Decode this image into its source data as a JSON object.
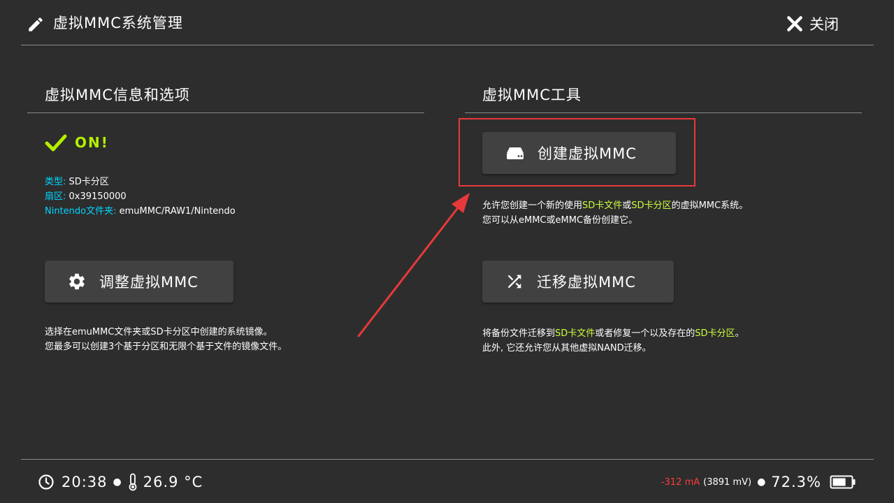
{
  "header": {
    "title": "虚拟MMC系统管理",
    "close_label": "关闭"
  },
  "left": {
    "section_title": "虚拟MMC信息和选项",
    "status": "ON!",
    "info": [
      {
        "key": "类型",
        "sep": ": ",
        "value": "SD卡分区"
      },
      {
        "key": "扇区",
        "sep": ": ",
        "value": "0x39150000"
      },
      {
        "key": "Nintendo文件夹",
        "sep": ": ",
        "value": "emuMMC/RAW1/Nintendo"
      }
    ],
    "adjust_button": "调整虚拟MMC",
    "adjust_desc_1": "选择在emuMMC文件夹或SD卡分区中创建的系统镜像。",
    "adjust_desc_2": "您最多可以创建3个基于分区和无限个基于文件的镜像文件。"
  },
  "right": {
    "section_title": "虚拟MMC工具",
    "create_button": "创建虚拟MMC",
    "create_desc": {
      "a": "允许您创建一个新的使用",
      "hl1": "SD卡文件",
      "b": "或",
      "hl2": "SD卡分区",
      "c": "的虚拟MMC系统。",
      "line2": "您可以从eMMC或eMMC备份创建它。"
    },
    "migrate_button": "迁移虚拟MMC",
    "migrate_desc": {
      "a": "将备份文件迁移到",
      "hl1": "SD卡文件",
      "b": "或者修复一个以及存在的",
      "hl2": "SD卡分区",
      "c": "。",
      "line2": "此外, 它还允许您从其他虚拟NAND迁移。"
    }
  },
  "footer": {
    "time": "20:38",
    "temperature": "26.9 °C",
    "current": "-312 mA",
    "voltage": "(3891 mV)",
    "battery_percent": "72.3%",
    "battery_level": 0.723
  },
  "colors": {
    "accent_green": "#b4f000",
    "info_key": "#00d5ff",
    "highlight": "#c8ff3c",
    "annotation_red": "#e8393a",
    "current_red": "#ff3b3b"
  }
}
